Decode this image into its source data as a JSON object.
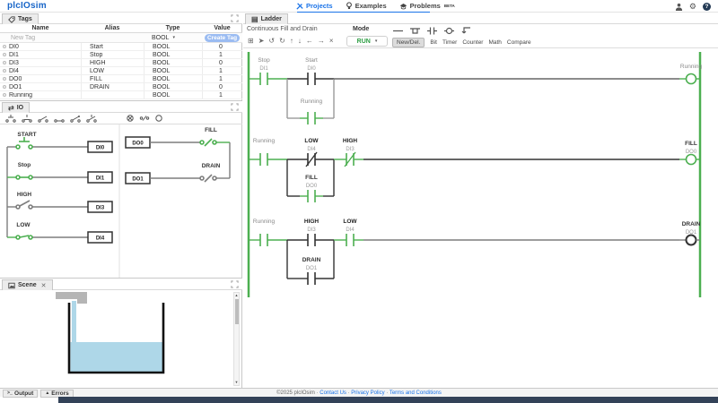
{
  "header": {
    "logo": "plcIOsim",
    "nav": [
      {
        "label": "Projects",
        "active": true
      },
      {
        "label": "Examples",
        "active": false
      },
      {
        "label": "Problems",
        "badge": "BETA",
        "active": false
      }
    ]
  },
  "tags": {
    "tab": "Tags",
    "columns": [
      "Name",
      "Alias",
      "Type",
      "Value"
    ],
    "new_row": {
      "name_placeholder": "New Tag",
      "type": "BOOL",
      "button": "Create Tag"
    },
    "rows": [
      {
        "name": "DI0",
        "alias": "Start",
        "type": "BOOL",
        "value": "0"
      },
      {
        "name": "DI1",
        "alias": "Stop",
        "type": "BOOL",
        "value": "1"
      },
      {
        "name": "DI3",
        "alias": "HIGH",
        "type": "BOOL",
        "value": "0"
      },
      {
        "name": "DI4",
        "alias": "LOW",
        "type": "BOOL",
        "value": "1"
      },
      {
        "name": "DO0",
        "alias": "FILL",
        "type": "BOOL",
        "value": "1"
      },
      {
        "name": "DO1",
        "alias": "DRAIN",
        "type": "BOOL",
        "value": "0"
      },
      {
        "name": "Running",
        "alias": "",
        "type": "BOOL",
        "value": "1"
      }
    ]
  },
  "io": {
    "tab": "IO",
    "inputs": [
      {
        "label": "START",
        "address": "DI0",
        "state": "on"
      },
      {
        "label": "Stop",
        "address": "DI1",
        "state": "on"
      },
      {
        "label": "HIGH",
        "address": "DI3",
        "state": "off"
      },
      {
        "label": "LOW",
        "address": "DI4",
        "state": "on"
      }
    ],
    "outputs": [
      {
        "label": "FILL",
        "address": "DO0",
        "state": "on"
      },
      {
        "label": "DRAIN",
        "address": "DO1",
        "state": "off"
      }
    ]
  },
  "scene": {
    "tab": "Scene"
  },
  "ladder": {
    "tab": "Ladder",
    "program_title": "Continuous Fill and Drain",
    "mode_label": "Mode",
    "mode_value": "RUN",
    "element_tabs": [
      "New/Del.",
      "Bit",
      "Timer",
      "Counter",
      "Math",
      "Compare"
    ],
    "rungs": [
      {
        "contacts": [
          {
            "name": "Stop",
            "addr": "DI1"
          },
          {
            "name": "Start",
            "addr": "DI0"
          }
        ],
        "branch": {
          "name": "Running",
          "addr": ""
        },
        "coil": {
          "name": "Running",
          "addr": ""
        }
      },
      {
        "contacts": [
          {
            "name": "Running",
            "addr": ""
          },
          {
            "name": "LOW",
            "addr": "DI4"
          },
          {
            "name": "HIGH",
            "addr": "DI3"
          }
        ],
        "branch": {
          "name": "FILL",
          "addr": "DO0"
        },
        "coil": {
          "name": "FILL",
          "addr": "DO0"
        }
      },
      {
        "contacts": [
          {
            "name": "Running",
            "addr": ""
          },
          {
            "name": "HIGH",
            "addr": "DI3"
          },
          {
            "name": "LOW",
            "addr": "DI4"
          }
        ],
        "branch": {
          "name": "DRAIN",
          "addr": "DO1"
        },
        "coil": {
          "name": "DRAIN",
          "addr": "DO1"
        }
      }
    ]
  },
  "footer": {
    "output_tab": "Output",
    "errors_tab": "Errors",
    "copyright": "©2025 plcIOsim",
    "links": [
      "Contact Us",
      "Privacy Policy",
      "Terms and Conditions"
    ]
  },
  "colors": {
    "energized_green": "#4caf50",
    "link_blue": "#1a73e8",
    "logo_blue": "#1966c8",
    "water_blue": "#aed7e8"
  }
}
